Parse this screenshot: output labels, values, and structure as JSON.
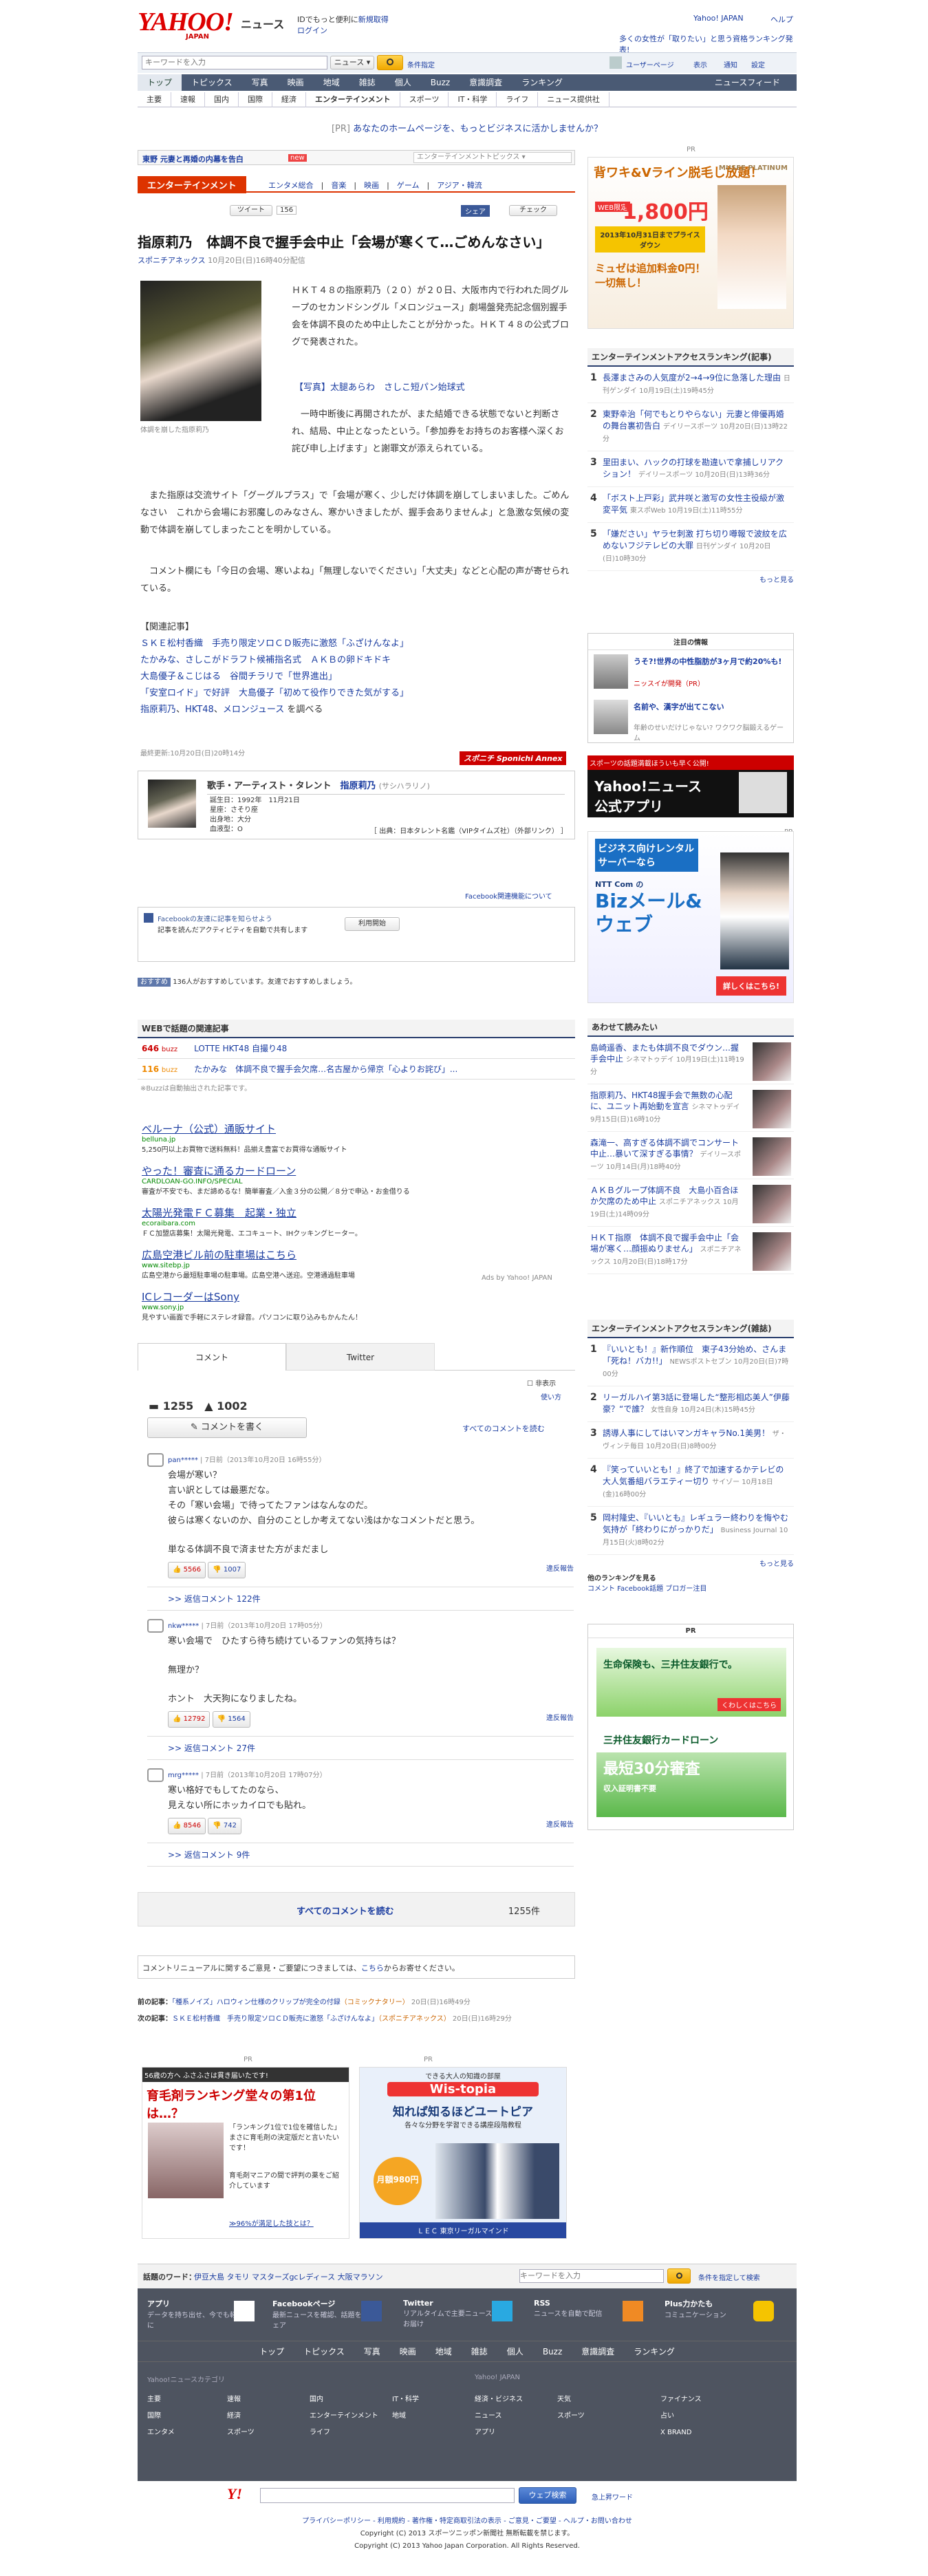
{
  "header": {
    "logo": "YAHOO!",
    "logo_sub": "JAPAN",
    "section": "ニュース",
    "promo": "IDでもっと便利に",
    "promo_link": "新規取得",
    "login": "ログイン",
    "top_links": [
      "Yahoo! JAPAN",
      "ヘルプ"
    ],
    "ranking_promo": "多くの女性が「取りたい」と思う資格ランキング発表!"
  },
  "search": {
    "placeholder": "キーワードを入力",
    "scope": "ニュース",
    "button_icon": "search-icon",
    "cond": "条件指定",
    "user_search": "ユーザーページ",
    "links": [
      "表示",
      "通知",
      "設定"
    ]
  },
  "nav": {
    "tabs": [
      "トップ",
      "トピックス",
      "写真",
      "映画",
      "地域",
      "雑誌",
      "個人",
      "Buzz",
      "意識調査",
      "ランキング"
    ],
    "right": "ニュースフィード",
    "sub": [
      "主要",
      "速報",
      "国内",
      "国際",
      "経済",
      "エンターテインメント",
      "スポーツ",
      "IT・科学",
      "ライフ",
      "ニュース提供社"
    ]
  },
  "pr_line": {
    "tag": "[PR]",
    "text": "あなたのホームページを、もっとビジネスに活かしませんか？"
  },
  "topic_strip": {
    "text": "東野 元妻と再婚の内幕を告白",
    "badge": "new",
    "select": "エンターテインメントトピックス"
  },
  "category_bar": {
    "label": "エンターテインメント",
    "links": [
      "エンタメ総合",
      "音楽",
      "映画",
      "ゲーム",
      "アジア・韓流"
    ]
  },
  "social": {
    "tweet": "ツイート",
    "tweet_count": "156",
    "share": "シェア",
    "check": "チェック"
  },
  "article": {
    "title": "指原莉乃　体調不良で握手会中止「会場が寒くて…ごめんなさい」",
    "source": "スポニチアネックス",
    "date": "10月20日(日)16時40分配信",
    "caption": "体調を崩した指原莉乃",
    "photo_link": "【写真】太腿あらわ　さしこ短パン始球式",
    "p1": "ＨＫＴ４８の指原莉乃（２０）が２０日、大阪市内で行われた同グループのセカンドシングル「メロンジュース」劇場盤発売記念個別握手会を体調不良のため中止したことが分かった。ＨＫＴ４８の公式ブログで発表された。",
    "p2": "一時中断後に再開されたが、また結婚できる状態でないと判断され、結局、中止となったという。「参加券をお持ちのお客様へ深くお詫び申し上げます」と謝罪文が添えられている。",
    "p3": "また指原は交流サイト「グーグルプラス」で「会場が寒く、少しだけ体調を崩してしまいました。ごめんなさい　これから会場にお邪魔しのみなさん、寒かいきましたが、握手会ありませんよ」と急激な気候の変動で体調を崩してしまったことを明かしている。",
    "p4": "コメント欄にも「今日の会場、寒いよね」「無理しないでください」「大丈夫」などと心配の声が寄せられている。",
    "related_title": "【関連記事】",
    "related": [
      "ＳＫＥ松村香織　手売り限定ソロＣＤ販売に激怒「ふざけんなよ」",
      "たかみな、さしこがドラフト候補指名式　ＡＫＢの卵ドキドキ",
      "大島優子＆こじはる　谷間チラリで「世界進出」",
      "「安室ロイド」で好評　大島優子「初めて役作りできた気がする」"
    ],
    "related_more": [
      "指原莉乃",
      "HKT48",
      "メロンジュース"
    ],
    "related_more_suffix": "を調べる",
    "updated": "最終更新:10月20日(日)20時14分",
    "sponichi": "スポニチ Sponichi Annex"
  },
  "profile": {
    "category": "歌手・アーティスト・タレント",
    "name": "指原莉乃",
    "kana": "(サシハラリノ)",
    "born": "誕生日：1992年　11月21日",
    "sign": "星座：さそり座",
    "birthplace": "出身地：大分",
    "blood": "血液型：O",
    "source": "［ 出典：日本タレント名鑑（VIPタイムズ社）（外部リンク） ］"
  },
  "facebook": {
    "settings": "Facebook関連機能について",
    "prompt": "Facebookの友達に記事を知らせよう",
    "sub": "記事を読んだアクティビティを自動で共有します",
    "start": "利用開始",
    "like": "おすすめ",
    "like_text": "136人がおすすめしています。友達でおすすめしましょう。"
  },
  "web_topics": {
    "title": "WEBで話題の関連記事",
    "rows": [
      {
        "count": "646",
        "unit": "buzz",
        "text": "LOTTE HKT48 自撮り48"
      },
      {
        "count": "116",
        "unit": "buzz",
        "text": "たかみな　体調不良で握手会欠席…名古屋から帰京「心よりお詫び」..."
      }
    ],
    "note": "※Buzzは自動抽出された記事です。"
  },
  "ads": [
    {
      "title": "ベルーナ（公式）通販サイト",
      "url": "belluna.jp",
      "desc": "5,250円以上お買物で送料無料！品揃え豊富でお買得な通販サイト"
    },
    {
      "title": "やった！審査に通るカードローン",
      "url": "CARDLOAN-GO.INFO/SPECIAL",
      "desc": "審査が不安でも、まだ諦めるな！簡単審査／入金３分の公開／８分で申込・お金借りる"
    },
    {
      "title": "太陽光発電ＦＣ募集　起業・独立",
      "url": "ecoraibara.com",
      "desc": "ＦＣ加盟店募集！太陽光発電、エコキュート、IHクッキングヒーター。"
    },
    {
      "title": "広島空港ビル前の駐車場はこちら",
      "url": "www.sitebp.jp",
      "desc": "広島空港から最短駐車場の駐車場。広島空港へ送迎。空港通過駐車場"
    },
    {
      "title": "ICレコーダーはSony",
      "url": "www.sony.jp",
      "desc": "見やすい画面で手軽にステレオ録音。パソコンに取り込みもかんたん！"
    }
  ],
  "ads_by": "Ads by Yahoo! JAPAN",
  "comments": {
    "tab1": "コメント",
    "tab2": "Twitter",
    "hide": "非表示",
    "howto": "使い方",
    "count": "1255",
    "likes": "1002",
    "write": "コメントを書く",
    "read_all": "すべてのコメントを読む",
    "items": [
      {
        "user": "pan*****",
        "meta": "7日前（2013年10月20日 16時55分）",
        "lines": [
          "会場が寒い？",
          "言い訳としては最悪だな。",
          "その「寒い会場」で待ってたファンはなんなのだ。",
          "彼らは寒くないのか、自分のことしか考えてない浅はかなコメントだと思う。",
          "",
          "単なる体調不良で済ませた方がまだまし"
        ],
        "up": "5566",
        "down": "1007",
        "report": "違反報告",
        "replies": ">> 返信コメント 122件"
      },
      {
        "user": "nkw*****",
        "meta": "7日前（2013年10月20日 17時05分）",
        "lines": [
          "寒い会場で　ひたすら待ち続けているファンの気持ちは？",
          "",
          "無理か？",
          "",
          "ホント　大天狗になりましたね。"
        ],
        "up": "12792",
        "down": "1564",
        "report": "違反報告",
        "replies": ">> 返信コメント 27件"
      },
      {
        "user": "mrg*****",
        "meta": "7日前（2013年10月20日 17時07分）",
        "lines": [
          "寒い格好でもしてたのなら、",
          "見えない所にホッカイロでも貼れ。"
        ],
        "up": "8546",
        "down": "742",
        "report": "違反報告",
        "replies": ">> 返信コメント 9件"
      }
    ],
    "read_all_bottom": "すべてのコメントを読む",
    "total": "1255件"
  },
  "renewal": {
    "text": "コメントリニューアルに関するご意見・ご要望につきましては、",
    "link": "こちら",
    "tail": "からお寄せください。"
  },
  "prevnext": {
    "prev_label": "前の記事：",
    "prev": "「種系ノイズ」ハロウィン仕様のクリップが完全の付録",
    "prev_src": "（コミックナタリー）",
    "prev_date": "20日(日)16時49分",
    "next_label": "次の記事：",
    "next": "ＳＫＥ松村香織　手売り限定ソロＣＤ販売に激怒「ふざけんなよ」",
    "next_src": "（スポニチアネックス）",
    "next_date": "20日(日)16時29分"
  },
  "bottom_ads": {
    "pr": "PR",
    "a1_head": "56歳の方へ ふさふさは貫き届いたです!",
    "a1_title": "育毛剤ランキング堂々の第1位は…？",
    "a1_text": "「ランキング1位で1位を確信した」まさに育毛剤の決定版だと言いたいです！",
    "a1_text2": "育毛剤マニアの間で評判の薬をご紹介しています",
    "a1_link": "≫96%が満足した技とは？",
    "a2_head": "できる大人の知識の部屋",
    "a2_brand": "Wis-topia",
    "a2_title": "知れば知るほどユートピア",
    "a2_sub": "各々な分野を学習できる講座段階教程",
    "a2_price": "月額980円",
    "a2_foot": "ＬＥＣ 東京リーガルマインド"
  },
  "sidebar": {
    "pr": "PR",
    "ad1_title": "背ワキ&Vライン脱毛し放題！",
    "ad1_price": "1,800円",
    "ad1_tag": "WEB限定",
    "ad1_deadline": "2013年10月31日までプライスダウン",
    "ad1_brand": "MUSEE PLATINUM",
    "ad1_tail": "ミュゼは追加料金0円！一切無し！",
    "rank1_title": "エンターテインメントアクセスランキング(記事)",
    "rank1": [
      {
        "n": "1",
        "t": "長澤まさみの人気度が2→4→9位に急落した理由",
        "s": "日刊ゲンダイ 10月19日(土)19時45分"
      },
      {
        "n": "2",
        "t": "東野幸治「何でもとりやらない」元妻と俳優再婚の舞台裏初告白",
        "s": "デイリースポーツ 10月20日(日)13時22分"
      },
      {
        "n": "3",
        "t": "里田まい、ハックの打球を勘違いで拿捕しリアクション！",
        "s": "デイリースポーツ 10月20日(日)13時36分"
      },
      {
        "n": "4",
        "t": "「ボスト上戸彩」武井咲と激写の女性主役級が激変平気",
        "s": "東スポWeb 10月19日(土)11時55分"
      },
      {
        "n": "5",
        "t": "「嫌ださい」ヤラセ刺激 打ち切り噂報で波紋を広めないフジテレビの大罪",
        "s": "日刊ゲンダイ 10月20日(日)10時30分"
      }
    ],
    "more": "もっと見る",
    "note_title": "注目の情報",
    "note": [
      {
        "t": "うそ?!世界の中性脂肪が3ヶ月で約20%も!",
        "s": "ニッスイが開発（PR）"
      },
      {
        "t": "名前や、漢字が出てこない",
        "s": "年齢のせいだけじゃない? ワクワク脳鍛えるゲーム"
      }
    ],
    "app_head": "スポーツの話題満載ほういも早く公開!",
    "app_title": "Yahoo!ニュース公式アプリ",
    "pr2": "PR",
    "ad2_title": "ビジネス向けレンタルサーバーなら",
    "ad2_brand": "NTT Com の",
    "ad2_big": "Bizメール&ウェブ",
    "ad2_cta": "詳しくはこちら!",
    "related_title": "あわせて読みたい",
    "related": [
      {
        "t": "島崎遥香、またも体調不良でダウン…握手会中止",
        "s": "シネマトゥデイ 10月19日(土)11時19分"
      },
      {
        "t": "指原莉乃、HKT48握手会で無数の心配に、ユニット再始動を宣言",
        "s": "シネマトゥデイ 9月15日(日)16時10分"
      },
      {
        "t": "森滝一、高すぎる体調不調でコンサート中止…暴いて深すぎる事情？",
        "s": "デイリースポーツ 10月14日(月)18時40分"
      },
      {
        "t": "ＡＫＢグループ体調不良　大島小百合ほか欠席のため中止",
        "s": "スポニチアネックス 10月19日(土)14時09分"
      },
      {
        "t": "ＨＫＴ指原　体調不良で握手会中止「会場が寒く…顔振ぬりません」",
        "s": "スポニチアネックス 10月20日(日)18時17分"
      }
    ],
    "rank2_title": "エンターテインメントアクセスランキング(雑誌)",
    "rank2": [
      {
        "n": "1",
        "t": "『いいとも！』新作順位　東子43分始め、さんま「死ね！バカ!!」",
        "s": "NEWSポストセブン 10月20日(日)7時00分"
      },
      {
        "n": "2",
        "t": "リーガルハイ第3話に登場した“整形相応美人”伊藤豪？“で誰？",
        "s": "女性自身 10月24日(木)15時45分"
      },
      {
        "n": "3",
        "t": "誘導人事にしてはいマンガキャラNo.1美男！",
        "s": "ザ・ヴィンテ毎日 10月20日(日)8時00分"
      },
      {
        "n": "4",
        "t": "『笑っていいとも！』終了で加速するかテレビの大人気番組バラエティー切り",
        "s": "サイゾー 10月18日(金)16時00分"
      },
      {
        "n": "5",
        "t": "岡村隆史、『いいとも』レギュラー終わりを悔やむ気持が「終わりにがっかりだ」",
        "s": "Business Journal 10月15日(火)8時02分"
      }
    ],
    "rank_more": "もっと見る",
    "other_rank": "他のランキングを見る",
    "other_links": "コメント Facebook話題 ブロガー注目",
    "pr3": "PR",
    "ad3_title": "生命保険も、三井住友銀行で。",
    "ad3_cta": "くわしくはこちら",
    "ad4_title": "三井住友銀行カードローン",
    "ad4_big": "最短30分審査",
    "ad4_sub": "収入証明書不要"
  },
  "footer": {
    "trend_label": "話題のワード：",
    "trend": "伊豆大島 タモリ マスターズgcレディース 大阪マラソン",
    "search_ph": "キーワードを入力",
    "search_sub": "条件を指定して検索",
    "apps": [
      {
        "t": "アプリ",
        "s": "データを持ち出せ、今でも軽量に"
      },
      {
        "t": "Facebookページ",
        "s": "最新ニュースを確認、話題をシェア"
      },
      {
        "t": "Twitter",
        "s": "リアルタイムで主要ニュースをお届け"
      },
      {
        "t": "RSS",
        "s": "ニュースを自動で配信"
      },
      {
        "t": "Plus力かたも",
        "s": "コミュニケーション"
      }
    ],
    "nav": [
      "トップ",
      "トピックス",
      "写真",
      "映画",
      "地域",
      "雑誌",
      "個人",
      "Buzz",
      "意識調査",
      "ランキング"
    ],
    "col_titles": [
      "Yahoo!ニュースカテゴリ",
      "Yahoo! JAPAN"
    ],
    "cols": [
      [
        "主要",
        "国際",
        "エンタメ"
      ],
      [
        "速報",
        "経済",
        "スポーツ"
      ],
      [
        "国内",
        "エンターテインメント",
        "ライフ"
      ],
      [
        "IT・科学",
        "地域"
      ],
      [
        "アプリ"
      ],
      [
        "経済・ビジネス",
        "ニュース",
        "天気",
        "スポーツ"
      ],
      [
        "ファイナンス",
        "占い",
        "X BRAND"
      ]
    ],
    "y_search": "ウェブ検索",
    "y_word": "急上昇ワード",
    "links": "プライバシーポリシー - 利用規約 - 著作権・特定商取引法の表示 - ご意見・ご要望 - ヘルプ・お問い合わせ",
    "copy1": "Copyright (C) 2013 スポーツニッポン新聞社 無断転載を禁じます。",
    "copy2": "Copyright (C) 2013 Yahoo Japan Corporation. All Rights Reserved."
  }
}
